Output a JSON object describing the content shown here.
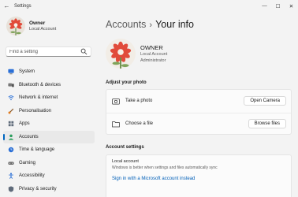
{
  "window": {
    "title": "Settings",
    "controls": {
      "minimize": "—",
      "maximize": "☐",
      "close": "✕"
    }
  },
  "user": {
    "name": "Owner",
    "account_type": "Local Account"
  },
  "search": {
    "placeholder": "Find a setting"
  },
  "nav": {
    "items": [
      {
        "label": "System",
        "icon": "monitor-icon"
      },
      {
        "label": "Bluetooth & devices",
        "icon": "bluetooth-icon"
      },
      {
        "label": "Network & internet",
        "icon": "network-icon"
      },
      {
        "label": "Personalisation",
        "icon": "brush-icon"
      },
      {
        "label": "Apps",
        "icon": "apps-icon"
      },
      {
        "label": "Accounts",
        "icon": "person-icon",
        "active": true
      },
      {
        "label": "Time & language",
        "icon": "globe-clock-icon"
      },
      {
        "label": "Gaming",
        "icon": "gamepad-icon"
      },
      {
        "label": "Accessibility",
        "icon": "accessibility-icon"
      },
      {
        "label": "Privacy & security",
        "icon": "shield-icon"
      }
    ]
  },
  "main": {
    "breadcrumb": {
      "parent": "Accounts",
      "separator": "›",
      "current": "Your info"
    },
    "profile": {
      "name": "OWNER",
      "account_type": "Local Account",
      "role": "Administrator"
    },
    "adjust_photo": {
      "title": "Adjust your photo",
      "take_photo": {
        "label": "Take a photo",
        "button": "Open Camera"
      },
      "choose_file": {
        "label": "Choose a file",
        "button": "Browse files"
      }
    },
    "account_settings": {
      "title": "Account settings",
      "local_account_title": "Local account",
      "local_account_desc": "Windows is better when settings and files automatically sync",
      "link": "Sign in with a Microsoft account instead"
    }
  },
  "colors": {
    "accent": "#0067c0",
    "link": "#005fb8",
    "background": "#f3f3f3",
    "card": "#fbfbfb"
  }
}
